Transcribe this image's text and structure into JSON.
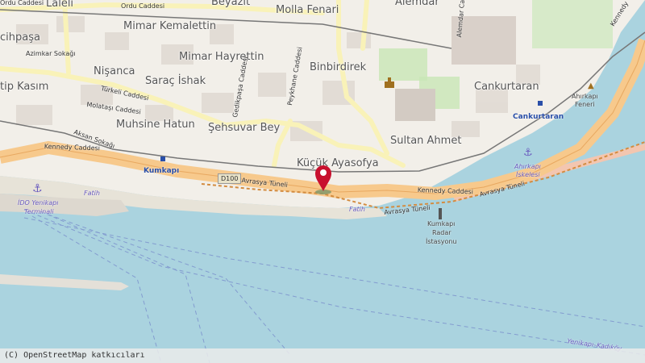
{
  "neighbourhoods": {
    "lalel": "Laleli",
    "ordu_top": "Ordu Caddesi",
    "beyazit": "Beyazıt",
    "mollafenari": "Molla Fenari",
    "alemdar": "Alemdar",
    "cihpasa": "cihpaşa",
    "mimar_kemalettin": "Mimar Kemalettin",
    "mimar_hayrettin": "Mimar Hayrettin",
    "binbirdirek": "Binbirdirek",
    "nisanca": "Nişanca",
    "sarac_ishak": "Saraç İshak",
    "kasim": "tip Kasım",
    "muhsine_hatun": "Muhsine Hatun",
    "sehsuvar_bey": "Şehsuvar Bey",
    "cankurtaran": "Cankurtaran",
    "sultan_ahmet": "Sultan Ahmet",
    "kucuk_ayasofya": "Küçük Ayasofya"
  },
  "streets": {
    "ordu": "Ordu Caddesi",
    "azimkar": "Azimkar Sokağı",
    "turkeli": "Türkeli Caddesi",
    "molatasi": "Molataşı Caddesi",
    "kennedy_left": "Kennedy Caddesi",
    "aksan": "Aksan Sokağı",
    "gedikpasa": "Gedikpaşa Caddesi",
    "peykhane": "Peykhane Caddesi",
    "alemdar_cad": "Alemdar Caddesi",
    "kennedy_right": "Kennedy Caddesi",
    "kennedy_top_right": "Kennedy",
    "avrasya_1": "Avrasya Tüneli",
    "avrasya_2": "Avrasya Tüneli",
    "avrasya_3": "Avrasya Tüneli",
    "fatih_1": "Fatih",
    "fatih_2": "Fatih"
  },
  "road_shield": "D100",
  "stations": {
    "kumkapi": "Kumkapı",
    "cankurtaran": "Cankurtaran"
  },
  "ferry": {
    "ido_line1": "İDO Yenikapı",
    "ido_line2": "Terminali",
    "ahirkapi_line1": "Ahırkapı",
    "ahirkapi_line2": "İskelesi",
    "route": "Yenikapı–Kadıköy"
  },
  "pois": {
    "ahirkapi_feneri_1": "Ahırkapı",
    "ahirkapi_feneri_2": "Feneri",
    "radar_1": "Kumkapı",
    "radar_2": "Radar",
    "radar_3": "İstasyonu"
  },
  "attribution": "(C) OpenStreetMap katkıcıları",
  "colors": {
    "sea": "#aad3df",
    "land": "#f2efe9",
    "road_major": "#f9f2b8",
    "highway": "#f7c98c",
    "marker": "#c8102e",
    "park": "#c8e6b5"
  }
}
